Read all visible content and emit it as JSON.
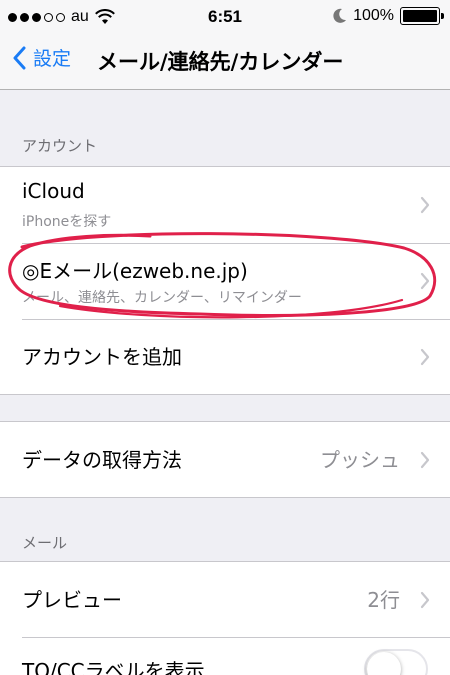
{
  "status_bar": {
    "carrier": "au",
    "time": "6:51",
    "battery": "100%",
    "signal_bars_filled": 3,
    "signal_bars_total": 5
  },
  "nav": {
    "back_label": "設定",
    "title": "メール/連絡先/カレンダー"
  },
  "sections": {
    "accounts_header": "アカウント",
    "mail_header": "メール"
  },
  "accounts": [
    {
      "title": "iCloud",
      "subtitle": "iPhoneを探す"
    },
    {
      "title": "◎Eメール(ezweb.ne.jp)",
      "subtitle": "メール、連絡先、カレンダー、リマインダー"
    },
    {
      "title": "アカウントを追加"
    }
  ],
  "fetch": {
    "title": "データの取得方法",
    "value": "プッシュ"
  },
  "mail": {
    "preview": {
      "title": "プレビュー",
      "value": "2行"
    },
    "to_cc": {
      "title": "TO/CCラベルを表示",
      "enabled": false
    }
  },
  "colors": {
    "accent": "#1a7cf5",
    "annotation": "#e0204a",
    "group_bg": "#efeff4"
  }
}
